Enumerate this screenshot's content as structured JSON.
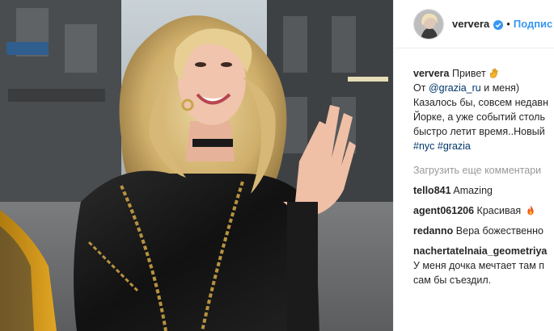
{
  "post": {
    "username": "ververa",
    "follow_label": "Подпис",
    "dot": "•"
  },
  "caption": {
    "author": "ververa",
    "greeting": "Привет",
    "line2_prefix": "От",
    "line2_mention": "@grazia_ru",
    "line2_suffix": "и меня)",
    "line3": "Казалось бы, совсем недавн",
    "line4": "Йорке, а уже событий столь",
    "line5": "быстро летит время..Новый",
    "hashtag1": "#nyc",
    "hashtag2": "#grazia"
  },
  "load_more_label": "Загрузить еще комментари",
  "comments": [
    {
      "user": "tello841",
      "text": "Amazing"
    },
    {
      "user": "agent061206",
      "text": "Красивая"
    },
    {
      "user": "redanno",
      "text": "Вера божественно"
    },
    {
      "user": "nachertatelnaia_geometriya",
      "text_line1": "У меня дочка мечтает там п",
      "text_line2": "сам бы съездил."
    }
  ],
  "icons": {
    "verified": "verified-badge-icon",
    "waving_hand": "waving-hand-icon",
    "fire": "fire-icon"
  },
  "colors": {
    "link_blue": "#3897f0",
    "mention": "#003569",
    "muted": "#999999"
  }
}
